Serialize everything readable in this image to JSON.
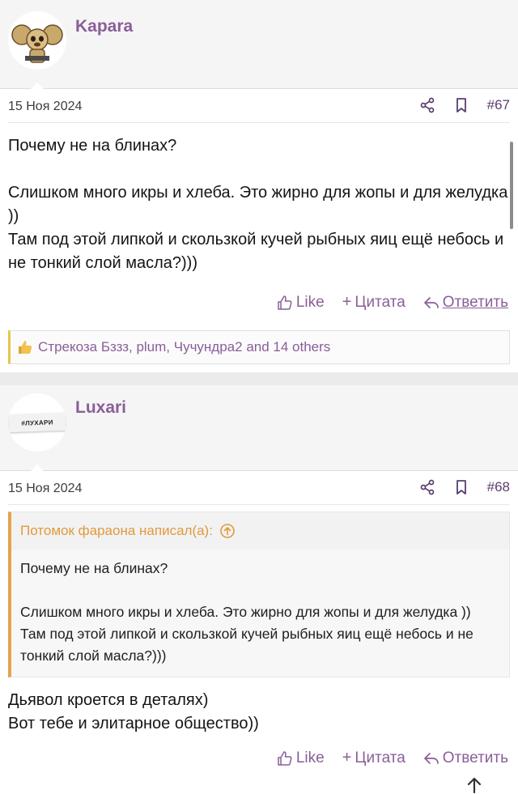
{
  "posts": [
    {
      "username": "Kapara",
      "date": "15 Ноя 2024",
      "number": "#67",
      "paragraphs": [
        "Почему не на блинах?",
        "",
        "Слишком много икры и хлеба. Это жирно для жопы и для желудка ))",
        "Там под этой липкой и скользкой кучей рыбных яиц ещё небось и не тонкий слой масла?)))"
      ],
      "actions": {
        "like": "Like",
        "quote": "Цитата",
        "reply": "Ответить"
      },
      "reactions": "Стрекоза Бззз, plum, Чучундра2 and 14 others"
    },
    {
      "username": "Luxari",
      "avatar_text": "#ЛУХАРИ",
      "date": "15 Ноя 2024",
      "number": "#68",
      "quote": {
        "header": "Потомок фараона написал(а):",
        "paragraphs": [
          "Почему не на блинах?",
          "",
          "Слишком много икры и хлеба. Это жирно для жопы и для желудка ))",
          "Там под этой липкой и скользкой кучей рыбных яиц ещё небось и не тонкий слой масла?)))"
        ]
      },
      "paragraphs": [
        "Дьявол кроется в деталях)",
        "Вот тебе и элитарное общество))"
      ],
      "actions": {
        "like": "Like",
        "quote": "Цитата",
        "reply": "Ответить"
      }
    }
  ],
  "colors": {
    "accent": "#8a5e98",
    "quote_accent": "#e5a24a",
    "reaction_bar": "#e6c64a"
  }
}
